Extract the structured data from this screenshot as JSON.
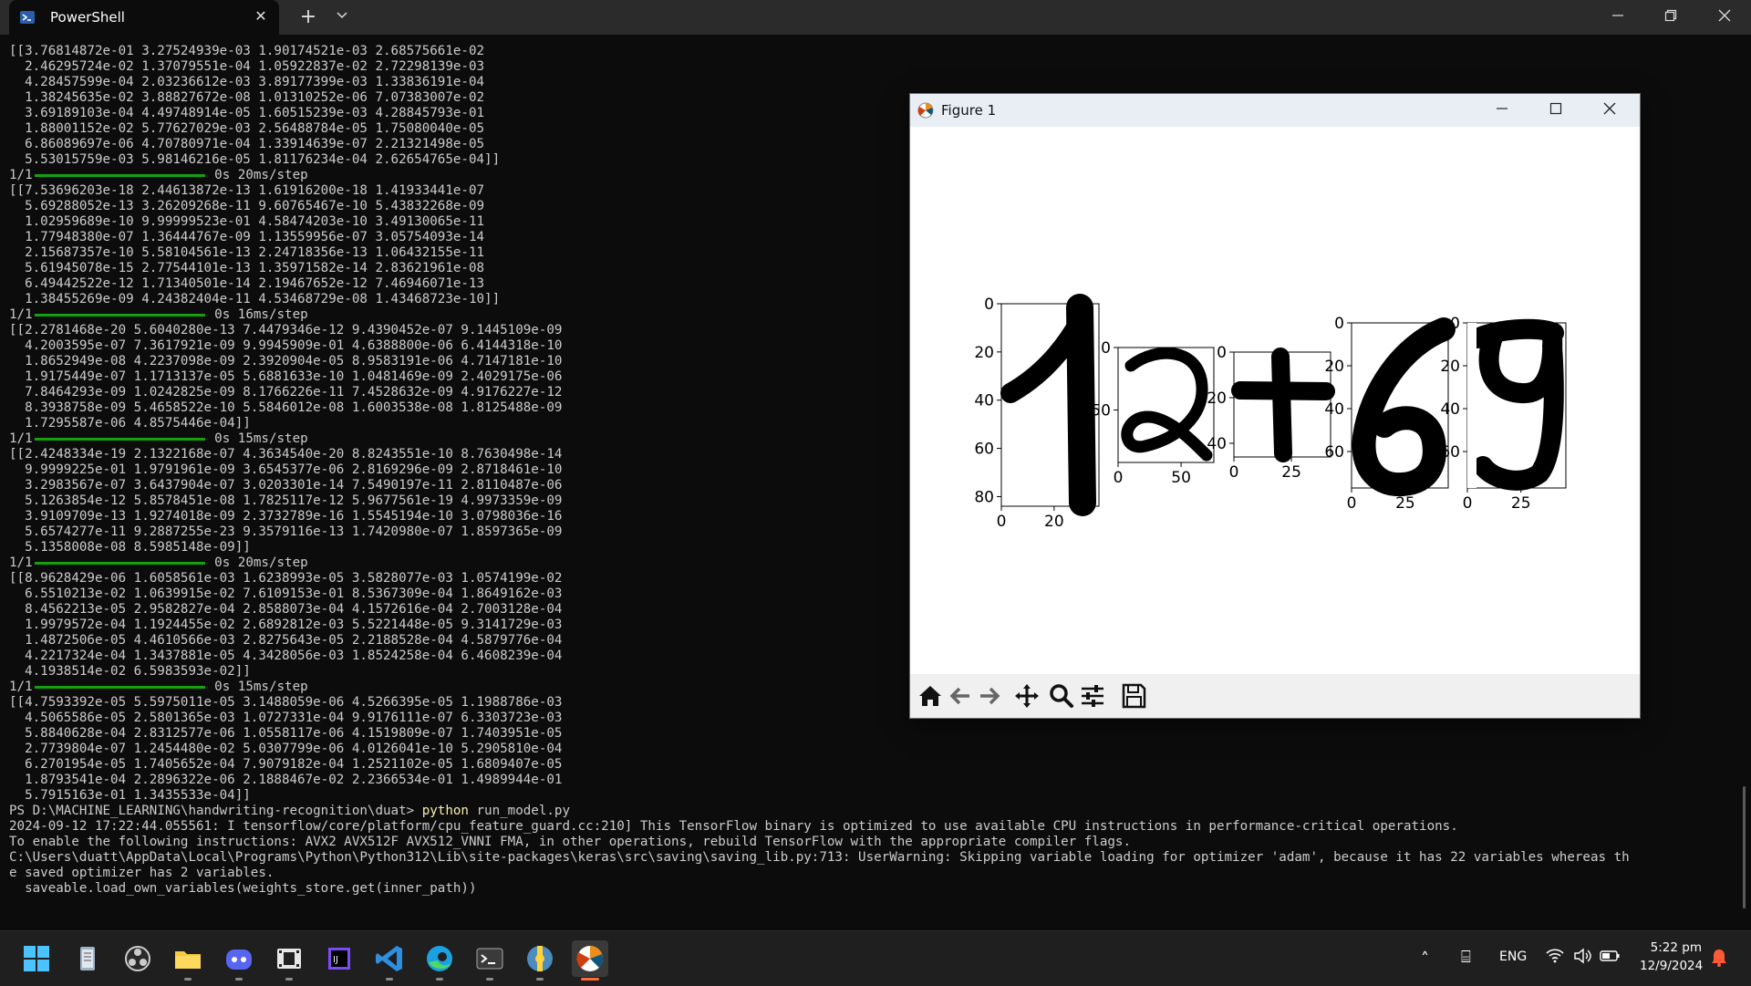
{
  "window": {
    "tab_title": "PowerShell",
    "new_tab_glyph": "+",
    "dropdown_glyph": "⌄",
    "close_glyph": "✕"
  },
  "terminal": {
    "lines": [
      {
        "text": "[[3.76814872e-01 3.27524939e-03 1.90174521e-03 2.68575661e-02"
      },
      {
        "text": "  2.46295724e-02 1.37079551e-04 1.05922837e-02 2.72298139e-03"
      },
      {
        "text": "  4.28457599e-04 2.03236612e-03 3.89177399e-03 1.33836191e-04"
      },
      {
        "text": "  1.38245635e-02 3.88827672e-08 1.01310252e-06 7.07383007e-02"
      },
      {
        "text": "  3.69189103e-04 4.49748914e-05 1.60515239e-03 4.28845793e-01"
      },
      {
        "text": "  1.88001152e-02 5.77627029e-03 2.56488784e-05 1.75080040e-05"
      },
      {
        "text": "  6.86089697e-06 4.70780971e-04 1.33914639e-07 2.21321498e-05"
      },
      {
        "text": "  5.53015759e-03 5.98146216e-05 1.81176234e-04 2.62654765e-04]]"
      },
      {
        "text": "1/1",
        "bar": true,
        "after": "0s 20ms/step"
      },
      {
        "text": "[[7.53696203e-18 2.44613872e-13 1.61916200e-18 1.41933441e-07"
      },
      {
        "text": "  5.69288052e-13 3.26209268e-11 9.60765467e-10 5.43832268e-09"
      },
      {
        "text": "  1.02959689e-10 9.99999523e-01 4.58474203e-10 3.49130065e-11"
      },
      {
        "text": "  1.77948380e-07 1.36444767e-09 1.13559956e-07 3.05754093e-14"
      },
      {
        "text": "  2.15687357e-10 5.58104561e-13 2.24718356e-13 1.06432155e-11"
      },
      {
        "text": "  5.61945078e-15 2.77544101e-13 1.35971582e-14 2.83621961e-08"
      },
      {
        "text": "  6.49442522e-12 1.71340501e-14 2.19467652e-12 7.46946071e-13"
      },
      {
        "text": "  1.38455269e-09 4.24382404e-11 4.53468729e-08 1.43468723e-10]]"
      },
      {
        "text": "1/1",
        "bar": true,
        "after": "0s 16ms/step"
      },
      {
        "text": "[[2.2781468e-20 5.6040280e-13 7.4479346e-12 9.4390452e-07 9.1445109e-09"
      },
      {
        "text": "  4.2003595e-07 7.3617921e-09 9.9945909e-01 4.6388800e-06 6.4144318e-10"
      },
      {
        "text": "  1.8652949e-08 4.2237098e-09 2.3920904e-05 8.9583191e-06 4.7147181e-10"
      },
      {
        "text": "  1.9175449e-07 1.1713137e-05 5.6881633e-10 1.0481469e-09 2.4029175e-06"
      },
      {
        "text": "  7.8464293e-09 1.0242825e-09 8.1766226e-11 7.4528632e-09 4.9176227e-12"
      },
      {
        "text": "  8.3938758e-09 5.4658522e-10 5.5846012e-08 1.6003538e-08 1.8125488e-09"
      },
      {
        "text": "  1.7295587e-06 4.8575446e-04]]"
      },
      {
        "text": "1/1",
        "bar": true,
        "after": "0s 15ms/step"
      },
      {
        "text": "[[2.4248334e-19 2.1322168e-07 4.3634540e-20 8.8243551e-10 8.7630498e-14"
      },
      {
        "text": "  9.9999225e-01 1.9791961e-09 3.6545377e-06 2.8169296e-09 2.8718461e-10"
      },
      {
        "text": "  3.2983567e-07 3.6437904e-07 3.0203301e-14 7.5490197e-11 2.8110487e-06"
      },
      {
        "text": "  5.1263854e-12 5.8578451e-08 1.7825117e-12 5.9677561e-19 4.9973359e-09"
      },
      {
        "text": "  3.9109709e-13 1.9274018e-09 2.3732789e-16 1.5545194e-10 3.0798036e-16"
      },
      {
        "text": "  5.6574277e-11 9.2887255e-23 9.3579116e-13 1.7420980e-07 1.8597365e-09"
      },
      {
        "text": "  5.1358008e-08 8.5985148e-09]]"
      },
      {
        "text": "1/1",
        "bar": true,
        "after": "0s 20ms/step"
      },
      {
        "text": "[[8.9628429e-06 1.6058561e-03 1.6238993e-05 3.5828077e-03 1.0574199e-02"
      },
      {
        "text": "  6.5510213e-02 1.0639915e-02 7.6109153e-01 8.5367309e-04 1.8649162e-03"
      },
      {
        "text": "  8.4562213e-05 2.9582827e-04 2.8588073e-04 4.1572616e-04 2.7003128e-04"
      },
      {
        "text": "  1.9979572e-04 1.1924455e-02 2.6892812e-03 5.5221448e-05 9.3141729e-03"
      },
      {
        "text": "  1.4872506e-05 4.4610566e-03 2.8275643e-05 2.2188528e-04 4.5879776e-04"
      },
      {
        "text": "  4.2217324e-04 1.3437881e-05 4.3428056e-03 1.8524258e-04 6.4608239e-04"
      },
      {
        "text": "  4.1938514e-02 6.5983593e-02]]"
      },
      {
        "text": "1/1",
        "bar": true,
        "after": "0s 15ms/step"
      },
      {
        "text": "[[4.7593392e-05 5.5975011e-05 3.1488059e-06 4.5266395e-05 1.1988786e-03"
      },
      {
        "text": "  4.5065586e-05 2.5801365e-03 1.0727331e-04 9.9176111e-07 6.3303723e-03"
      },
      {
        "text": "  5.8840628e-04 2.8312577e-06 1.0558117e-06 4.1519809e-07 1.7403951e-05"
      },
      {
        "text": "  2.7739804e-07 1.2454480e-02 5.0307799e-06 4.0126041e-10 5.2905810e-04"
      },
      {
        "text": "  6.2701954e-05 1.7405652e-04 7.9079182e-04 1.2521102e-05 1.6809407e-05"
      },
      {
        "text": "  1.8793541e-04 2.2896322e-06 2.1888467e-02 2.2366534e-01 1.4989944e-01"
      },
      {
        "text": "  5.7915163e-01 1.3435533e-04]]"
      },
      {
        "text": "PS D:\\MACHINE_LEARNING\\handwriting-recognition\\duat> ",
        "cmd": "python",
        "after": " run_model.py"
      },
      {
        "text": "2024-09-12 17:22:44.055561: I tensorflow/core/platform/cpu_feature_guard.cc:210] This TensorFlow binary is optimized to use available CPU instructions in performance-critical operations."
      },
      {
        "text": "To enable the following instructions: AVX2 AVX512F AVX512_VNNI FMA, in other operations, rebuild TensorFlow with the appropriate compiler flags."
      },
      {
        "text": "C:\\Users\\duatt\\AppData\\Local\\Programs\\Python\\Python312\\Lib\\site-packages\\keras\\src\\saving\\saving_lib.py:713: UserWarning: Skipping variable loading for optimizer 'adam', because it has 22 variables whereas th"
      },
      {
        "text": "e saved optimizer has 2 variables."
      },
      {
        "text": "  saveable.load_own_variables(weights_store.get(inner_path))"
      }
    ]
  },
  "figure": {
    "title": "Figure 1",
    "subplots": [
      {
        "xticks": [
          "0",
          "20"
        ],
        "yticks": [
          "0",
          "20",
          "40",
          "60",
          "80"
        ]
      },
      {
        "xticks": [
          "0",
          "50"
        ],
        "yticks": [
          "0",
          "50"
        ]
      },
      {
        "xticks": [
          "0",
          "25"
        ],
        "yticks": [
          "0",
          "20",
          "40"
        ]
      },
      {
        "xticks": [
          "0",
          "25"
        ],
        "yticks": [
          "0",
          "20",
          "40",
          "60"
        ]
      },
      {
        "xticks": [
          "0",
          "25"
        ],
        "yticks": [
          "0",
          "20",
          "40",
          "60"
        ]
      }
    ],
    "toolbar": [
      "home-icon",
      "back-arrow-icon",
      "forward-arrow-icon",
      "pan-icon",
      "zoom-icon",
      "configure-subplots-icon",
      "save-icon"
    ]
  },
  "taskbar": {
    "apps": [
      "windows-start-icon",
      "notepad-icon",
      "obs-icon",
      "file-explorer-icon",
      "discord-icon",
      "video-editor-icon",
      "jetbrains-icon",
      "vscode-icon",
      "edge-icon",
      "terminal-icon",
      "python-icon",
      "matplotlib-icon"
    ],
    "lang": "ENG",
    "time": "5:22 pm",
    "date": "12/9/2024"
  }
}
